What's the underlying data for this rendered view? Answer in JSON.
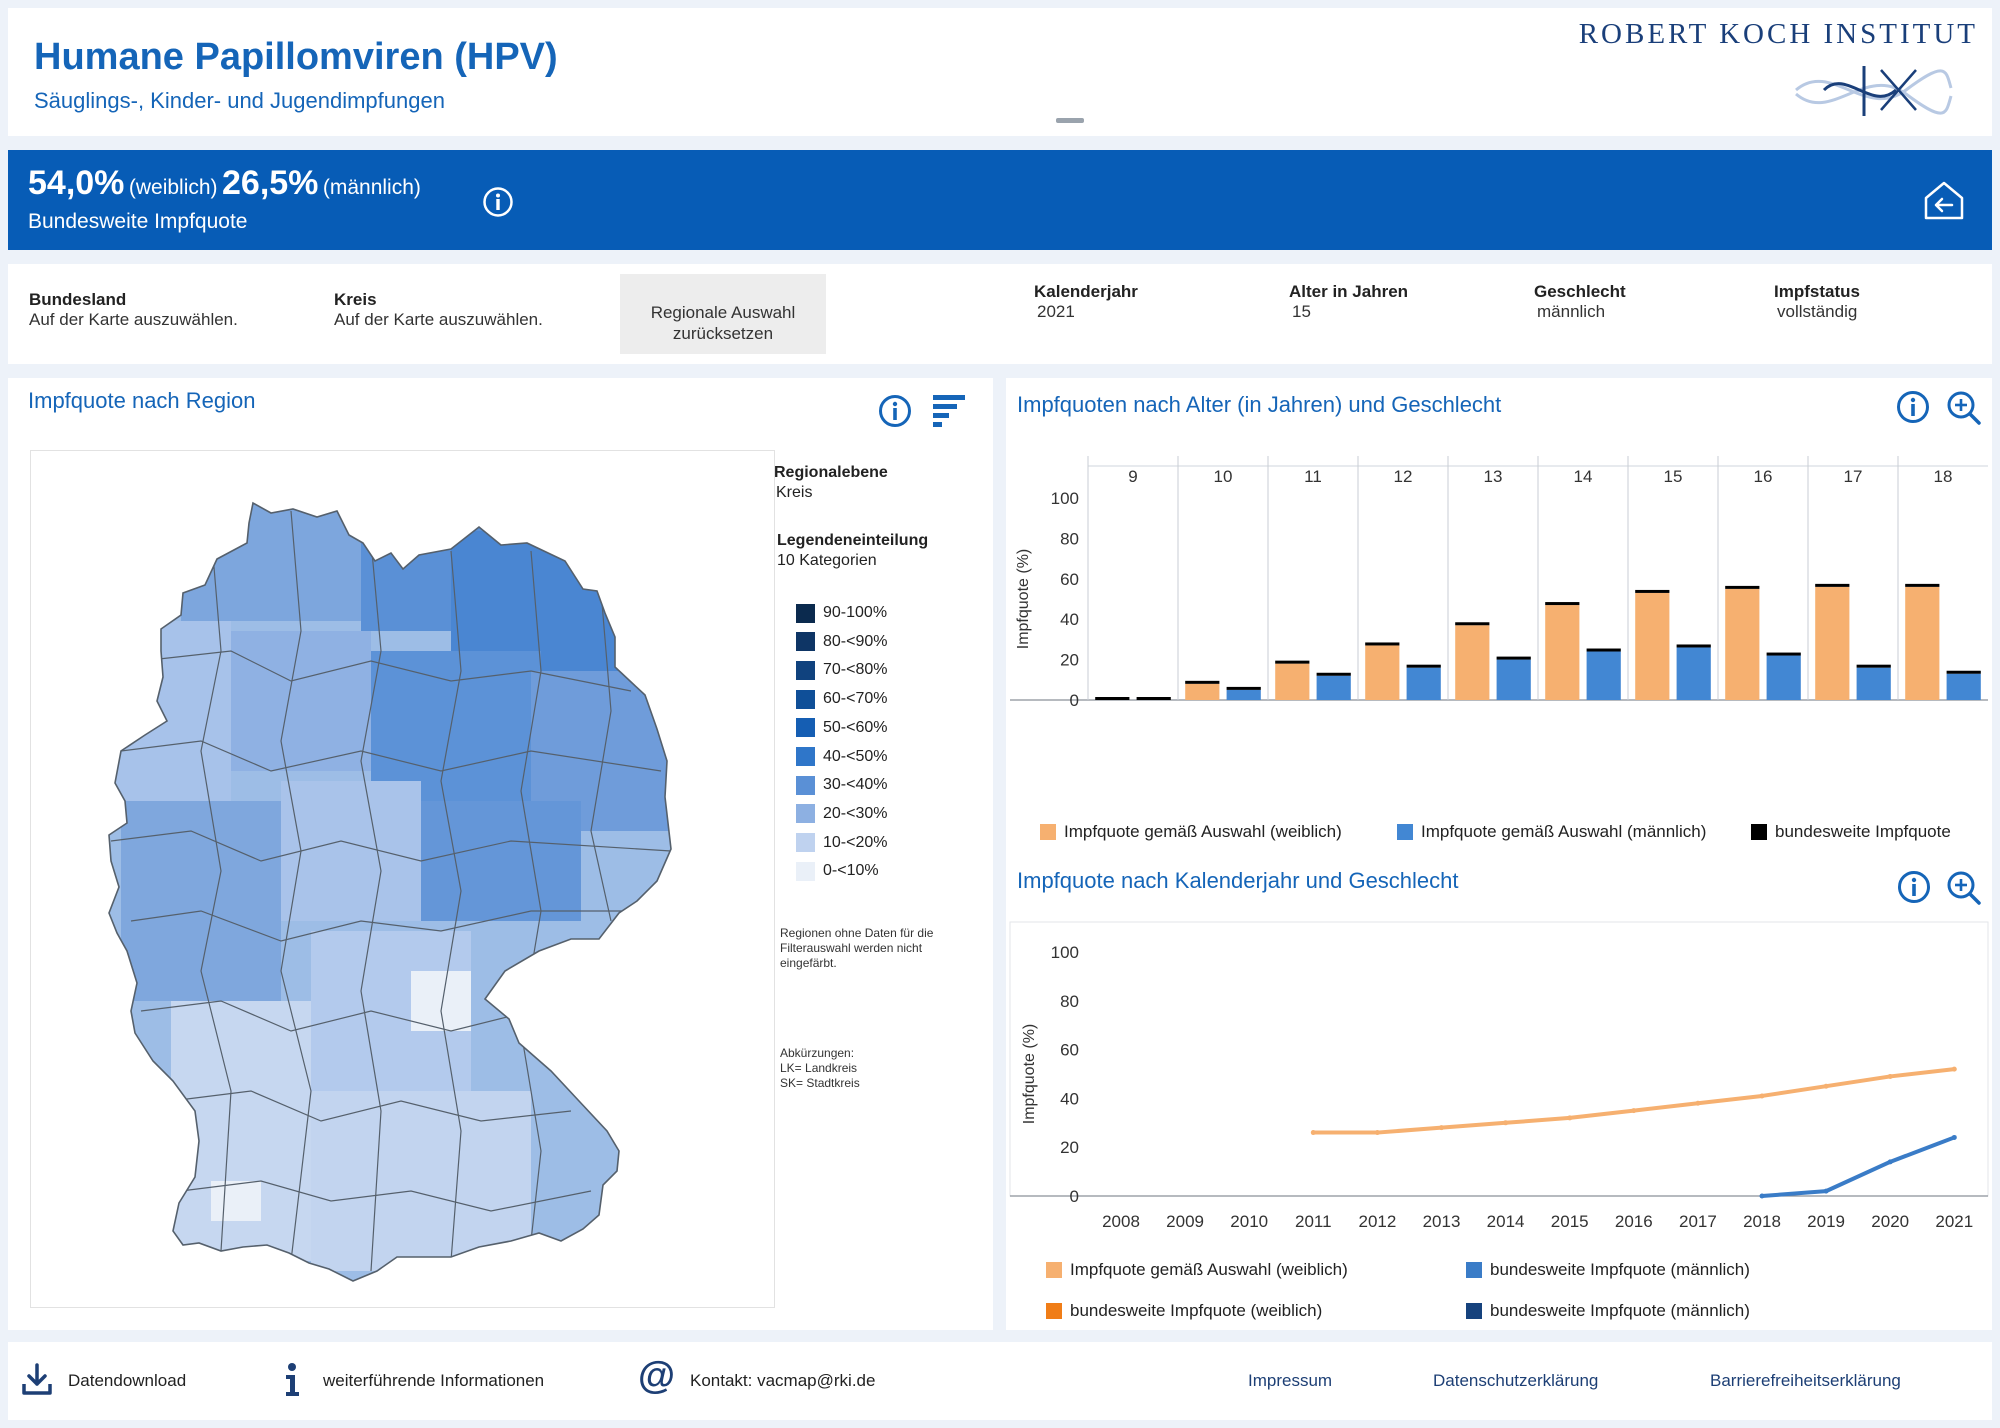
{
  "header": {
    "title": "Humane Papillomviren (HPV)",
    "subtitle": "Säuglings-, Kinder- und Jugendimpfungen",
    "institute": "ROBERT KOCH INSTITUT"
  },
  "banner": {
    "female_rate": "54,0%",
    "female_label": "(weiblich)",
    "male_rate": "26,5%",
    "male_label": "(männlich)",
    "caption": "Bundesweite Impfquote"
  },
  "filters": {
    "bundesland_label": "Bundesland",
    "bundesland_value": "Auf der Karte auszuwählen.",
    "kreis_label": "Kreis",
    "kreis_value": "Auf der Karte auszuwählen.",
    "reset_line1": "Regionale Auswahl",
    "reset_line2": "zurücksetzen",
    "kalenderjahr_label": "Kalenderjahr",
    "kalenderjahr_value": "2021",
    "alter_label": "Alter in Jahren",
    "alter_value": "15",
    "geschlecht_label": "Geschlecht",
    "geschlecht_value": "männlich",
    "impfstatus_label": "Impfstatus",
    "impfstatus_value": "vollständig"
  },
  "map_panel": {
    "title": "Impfquote nach Region",
    "regionalebene_label": "Regionalebene",
    "regionalebene_value": "Kreis",
    "legend_label": "Legendeneinteilung",
    "legend_value": "10 Kategorien",
    "categories": [
      {
        "label": "90-100%",
        "color": "#0b2a4e"
      },
      {
        "label": "80-<90%",
        "color": "#0e3565"
      },
      {
        "label": "70-<80%",
        "color": "#10427e"
      },
      {
        "label": "60-<70%",
        "color": "#0f4f98"
      },
      {
        "label": "50-<60%",
        "color": "#155eb3"
      },
      {
        "label": "40-<50%",
        "color": "#2f76c9"
      },
      {
        "label": "30-<40%",
        "color": "#5a90d6"
      },
      {
        "label": "20-<30%",
        "color": "#8db0e2"
      },
      {
        "label": "10-<20%",
        "color": "#bfd2ef"
      },
      {
        "label": "0-<10%",
        "color": "#eaf0f8"
      }
    ],
    "note_nodata": [
      "Regionen ohne Daten für die",
      "Filterauswahl werden nicht",
      "eingefärbt."
    ],
    "note_abbr": [
      "Abkürzungen:",
      "LK= Landkreis",
      "SK= Stadtkreis"
    ]
  },
  "age_chart": {
    "title": "Impfquoten nach Alter (in Jahren) und Geschlecht",
    "legend_f": "Impfquote gemäß Auswahl (weiblich)",
    "legend_m": "Impfquote gemäß Auswahl (männlich)",
    "legend_nat": "bundesweite Impfquote"
  },
  "year_chart": {
    "title": "Impfquote nach Kalenderjahr und Geschlecht",
    "legend_f": "Impfquote gemäß Auswahl (weiblich)",
    "legend_m_nat": "bundesweite Impfquote (männlich)",
    "legend_f_nat": "bundesweite Impfquote (weiblich)",
    "legend_m_nat2": "bundesweite Impfquote (männlich)"
  },
  "colors": {
    "female": "#f6b070",
    "male": "#4287d3",
    "national": "#000000",
    "female_line": "#f6b070",
    "male_line": "#3a7cc7",
    "female_nat": "#f07d17",
    "male_nat": "#16427d"
  },
  "chart_data": [
    {
      "type": "bar",
      "title": "Impfquoten nach Alter (in Jahren) und Geschlecht",
      "ylabel": "Impfquote (%)",
      "ylim": [
        0,
        100
      ],
      "yticks": [
        0,
        20,
        40,
        60,
        80,
        100
      ],
      "categories": [
        "9",
        "10",
        "11",
        "12",
        "13",
        "14",
        "15",
        "16",
        "17",
        "18"
      ],
      "series": [
        {
          "name": "Impfquote gemäß Auswahl (weiblich)",
          "values": [
            0,
            8,
            18,
            27,
            37,
            47,
            53,
            55,
            56,
            56
          ]
        },
        {
          "name": "Impfquote gemäß Auswahl (männlich)",
          "values": [
            0,
            5,
            12,
            16,
            20,
            24,
            26,
            22,
            16,
            13
          ]
        },
        {
          "name": "bundesweite Impfquote",
          "values_f": [
            0,
            8,
            18,
            27,
            37,
            47,
            53,
            55,
            56,
            56
          ],
          "values_m": [
            0,
            5,
            12,
            16,
            20,
            24,
            26,
            22,
            16,
            13
          ]
        }
      ],
      "legend": "bottom"
    },
    {
      "type": "line",
      "title": "Impfquote nach Kalenderjahr und Geschlecht",
      "ylabel": "Impfquote (%)",
      "ylim": [
        0,
        100
      ],
      "yticks": [
        0,
        20,
        40,
        60,
        80,
        100
      ],
      "x": [
        "2008",
        "2009",
        "2010",
        "2011",
        "2012",
        "2013",
        "2014",
        "2015",
        "2016",
        "2017",
        "2018",
        "2019",
        "2020",
        "2021"
      ],
      "series": [
        {
          "name": "Impfquote gemäß Auswahl (weiblich)",
          "values": [
            null,
            null,
            null,
            26,
            26,
            28,
            30,
            32,
            35,
            38,
            41,
            45,
            49,
            52
          ]
        },
        {
          "name": "bundesweite Impfquote (männlich)",
          "values": [
            null,
            null,
            null,
            null,
            null,
            null,
            null,
            null,
            null,
            null,
            0,
            2,
            14,
            24
          ]
        }
      ],
      "legend": "bottom"
    }
  ],
  "footer": {
    "download": "Datendownload",
    "info": "weiterführende Informationen",
    "contact": "Kontakt: vacmap@rki.de",
    "impressum": "Impressum",
    "privacy": "Datenschutzerklärung",
    "accessibility": "Barrierefreiheitserklärung"
  }
}
